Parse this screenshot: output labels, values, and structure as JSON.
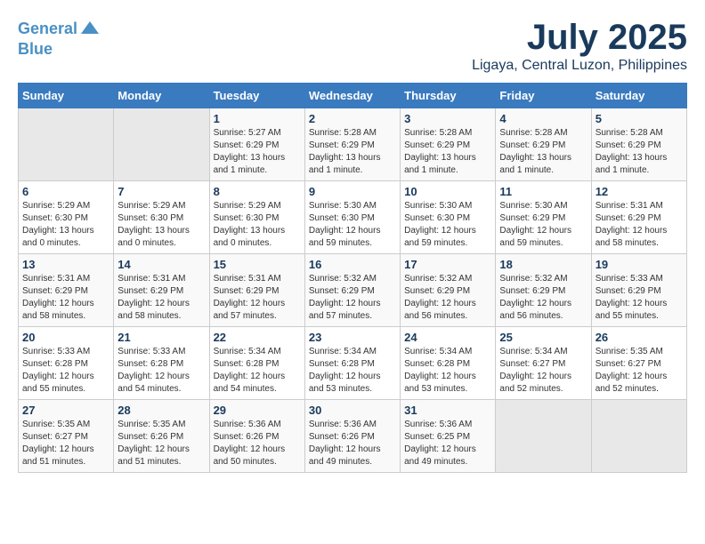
{
  "header": {
    "logo_line1": "General",
    "logo_line2": "Blue",
    "title": "July 2025",
    "subtitle": "Ligaya, Central Luzon, Philippines"
  },
  "calendar": {
    "headers": [
      "Sunday",
      "Monday",
      "Tuesday",
      "Wednesday",
      "Thursday",
      "Friday",
      "Saturday"
    ],
    "weeks": [
      [
        {
          "day": "",
          "info": ""
        },
        {
          "day": "",
          "info": ""
        },
        {
          "day": "1",
          "info": "Sunrise: 5:27 AM\nSunset: 6:29 PM\nDaylight: 13 hours and 1 minute."
        },
        {
          "day": "2",
          "info": "Sunrise: 5:28 AM\nSunset: 6:29 PM\nDaylight: 13 hours and 1 minute."
        },
        {
          "day": "3",
          "info": "Sunrise: 5:28 AM\nSunset: 6:29 PM\nDaylight: 13 hours and 1 minute."
        },
        {
          "day": "4",
          "info": "Sunrise: 5:28 AM\nSunset: 6:29 PM\nDaylight: 13 hours and 1 minute."
        },
        {
          "day": "5",
          "info": "Sunrise: 5:28 AM\nSunset: 6:29 PM\nDaylight: 13 hours and 1 minute."
        }
      ],
      [
        {
          "day": "6",
          "info": "Sunrise: 5:29 AM\nSunset: 6:30 PM\nDaylight: 13 hours and 0 minutes."
        },
        {
          "day": "7",
          "info": "Sunrise: 5:29 AM\nSunset: 6:30 PM\nDaylight: 13 hours and 0 minutes."
        },
        {
          "day": "8",
          "info": "Sunrise: 5:29 AM\nSunset: 6:30 PM\nDaylight: 13 hours and 0 minutes."
        },
        {
          "day": "9",
          "info": "Sunrise: 5:30 AM\nSunset: 6:30 PM\nDaylight: 12 hours and 59 minutes."
        },
        {
          "day": "10",
          "info": "Sunrise: 5:30 AM\nSunset: 6:30 PM\nDaylight: 12 hours and 59 minutes."
        },
        {
          "day": "11",
          "info": "Sunrise: 5:30 AM\nSunset: 6:29 PM\nDaylight: 12 hours and 59 minutes."
        },
        {
          "day": "12",
          "info": "Sunrise: 5:31 AM\nSunset: 6:29 PM\nDaylight: 12 hours and 58 minutes."
        }
      ],
      [
        {
          "day": "13",
          "info": "Sunrise: 5:31 AM\nSunset: 6:29 PM\nDaylight: 12 hours and 58 minutes."
        },
        {
          "day": "14",
          "info": "Sunrise: 5:31 AM\nSunset: 6:29 PM\nDaylight: 12 hours and 58 minutes."
        },
        {
          "day": "15",
          "info": "Sunrise: 5:31 AM\nSunset: 6:29 PM\nDaylight: 12 hours and 57 minutes."
        },
        {
          "day": "16",
          "info": "Sunrise: 5:32 AM\nSunset: 6:29 PM\nDaylight: 12 hours and 57 minutes."
        },
        {
          "day": "17",
          "info": "Sunrise: 5:32 AM\nSunset: 6:29 PM\nDaylight: 12 hours and 56 minutes."
        },
        {
          "day": "18",
          "info": "Sunrise: 5:32 AM\nSunset: 6:29 PM\nDaylight: 12 hours and 56 minutes."
        },
        {
          "day": "19",
          "info": "Sunrise: 5:33 AM\nSunset: 6:29 PM\nDaylight: 12 hours and 55 minutes."
        }
      ],
      [
        {
          "day": "20",
          "info": "Sunrise: 5:33 AM\nSunset: 6:28 PM\nDaylight: 12 hours and 55 minutes."
        },
        {
          "day": "21",
          "info": "Sunrise: 5:33 AM\nSunset: 6:28 PM\nDaylight: 12 hours and 54 minutes."
        },
        {
          "day": "22",
          "info": "Sunrise: 5:34 AM\nSunset: 6:28 PM\nDaylight: 12 hours and 54 minutes."
        },
        {
          "day": "23",
          "info": "Sunrise: 5:34 AM\nSunset: 6:28 PM\nDaylight: 12 hours and 53 minutes."
        },
        {
          "day": "24",
          "info": "Sunrise: 5:34 AM\nSunset: 6:28 PM\nDaylight: 12 hours and 53 minutes."
        },
        {
          "day": "25",
          "info": "Sunrise: 5:34 AM\nSunset: 6:27 PM\nDaylight: 12 hours and 52 minutes."
        },
        {
          "day": "26",
          "info": "Sunrise: 5:35 AM\nSunset: 6:27 PM\nDaylight: 12 hours and 52 minutes."
        }
      ],
      [
        {
          "day": "27",
          "info": "Sunrise: 5:35 AM\nSunset: 6:27 PM\nDaylight: 12 hours and 51 minutes."
        },
        {
          "day": "28",
          "info": "Sunrise: 5:35 AM\nSunset: 6:26 PM\nDaylight: 12 hours and 51 minutes."
        },
        {
          "day": "29",
          "info": "Sunrise: 5:36 AM\nSunset: 6:26 PM\nDaylight: 12 hours and 50 minutes."
        },
        {
          "day": "30",
          "info": "Sunrise: 5:36 AM\nSunset: 6:26 PM\nDaylight: 12 hours and 49 minutes."
        },
        {
          "day": "31",
          "info": "Sunrise: 5:36 AM\nSunset: 6:25 PM\nDaylight: 12 hours and 49 minutes."
        },
        {
          "day": "",
          "info": ""
        },
        {
          "day": "",
          "info": ""
        }
      ]
    ]
  }
}
